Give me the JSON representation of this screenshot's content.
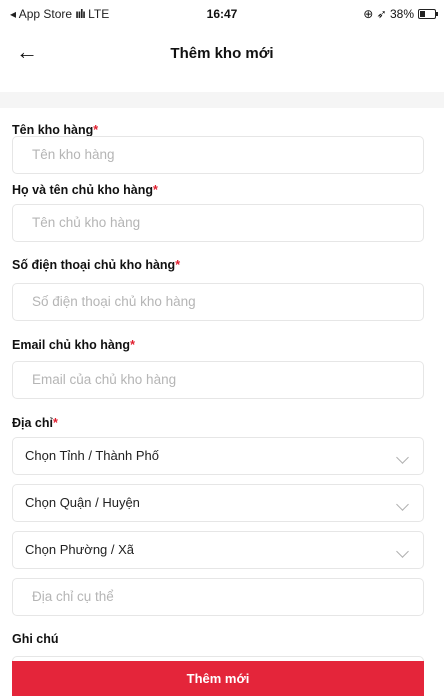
{
  "status_bar": {
    "carrier": "◂ App Store",
    "network": "LTE",
    "time": "16:47",
    "indicators": "⊕ ➶ 38%",
    "battery_percent": 38
  },
  "header": {
    "title": "Thêm kho mới"
  },
  "form": {
    "required_mark": "*",
    "warehouse_name": {
      "label": "Tên kho hàng",
      "placeholder": "Tên kho hàng"
    },
    "owner_name": {
      "label": "Họ và tên chủ kho hàng",
      "placeholder": "Tên chủ kho hàng"
    },
    "owner_phone": {
      "label": "Số điện thoại chủ kho hàng",
      "placeholder": "Số điện thoại chủ kho hàng"
    },
    "owner_email": {
      "label": "Email chủ kho hàng",
      "placeholder": "Email của chủ kho hàng"
    },
    "address": {
      "label": "Địa chỉ",
      "province": "Chọn Tỉnh / Thành Phố",
      "district": "Chọn Quận / Huyện",
      "ward": "Chọn Phường / Xã",
      "detail_placeholder": "Địa chỉ cụ thể"
    },
    "note": {
      "label": "Ghi chú"
    }
  },
  "submit_label": "Thêm mới",
  "colors": {
    "accent": "#e4253a"
  }
}
